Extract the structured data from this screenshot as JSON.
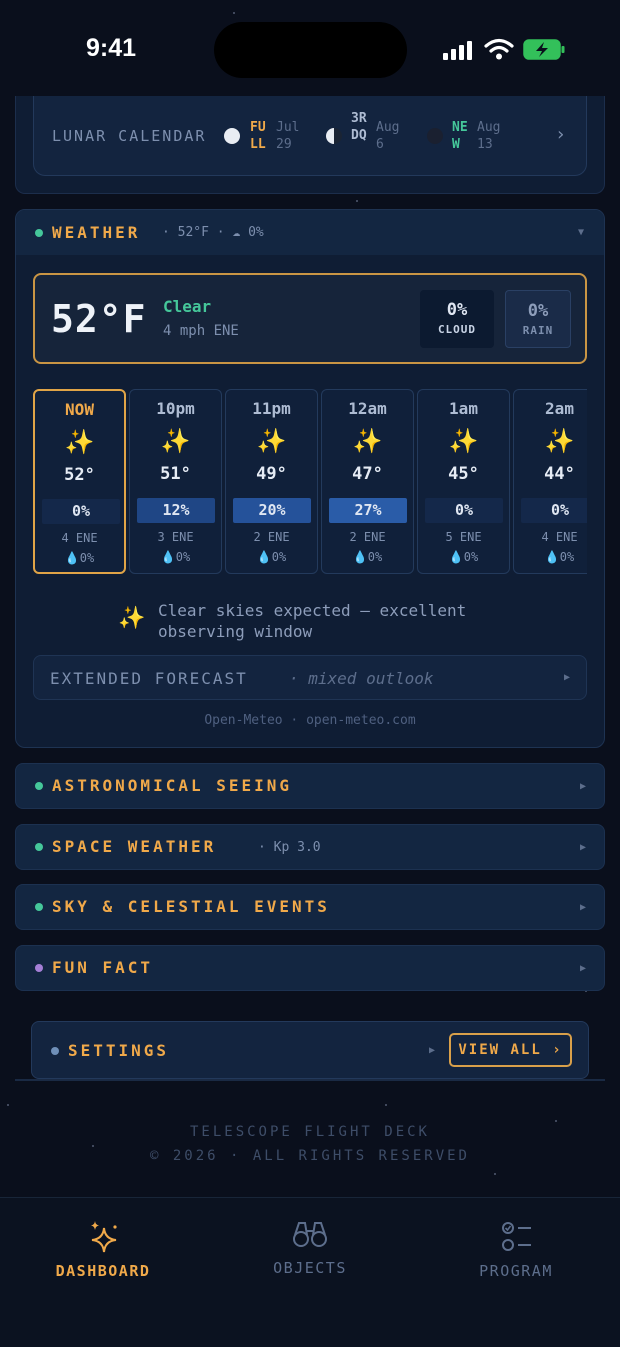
{
  "status_bar": {
    "time": "9:41"
  },
  "lunar": {
    "title": "LUNAR CALENDAR",
    "phases": [
      {
        "name": "FULL",
        "date": "Jul 29",
        "color": "#f0a94a"
      },
      {
        "name": "3RDQ",
        "date": "Aug 6",
        "color": "#aebcd3"
      },
      {
        "name": "NEW",
        "date": "Aug 13",
        "color": "#45c79a"
      }
    ]
  },
  "weather": {
    "title": "WEATHER",
    "summary": "· 52°F · ☁ 0%",
    "current": {
      "temp": "52°F",
      "condition": "Clear",
      "wind": "4 mph ENE"
    },
    "cloud": {
      "value": "0%",
      "label": "CLOUD"
    },
    "rain": {
      "value": "0%",
      "label": "RAIN"
    },
    "hourly": [
      {
        "label": "NOW",
        "icon": "✨",
        "temp": "52°",
        "cloud": "0%",
        "cloud_fraction": 0,
        "wind": "4 ENE",
        "rain": "💧0%"
      },
      {
        "label": "10pm",
        "icon": "✨",
        "temp": "51°",
        "cloud": "12%",
        "cloud_fraction": 0.12,
        "wind": "3 ENE",
        "rain": "💧0%"
      },
      {
        "label": "11pm",
        "icon": "✨",
        "temp": "49°",
        "cloud": "20%",
        "cloud_fraction": 0.2,
        "wind": "2 ENE",
        "rain": "💧0%"
      },
      {
        "label": "12am",
        "icon": "✨",
        "temp": "47°",
        "cloud": "27%",
        "cloud_fraction": 0.27,
        "wind": "2 ENE",
        "rain": "💧0%"
      },
      {
        "label": "1am",
        "icon": "✨",
        "temp": "45°",
        "cloud": "0%",
        "cloud_fraction": 0,
        "wind": "5 ENE",
        "rain": "💧0%"
      },
      {
        "label": "2am",
        "icon": "✨",
        "temp": "44°",
        "cloud": "0%",
        "cloud_fraction": 0,
        "wind": "4 ENE",
        "rain": "💧0%"
      }
    ],
    "observing_icon": "✨",
    "observing_line1": "Clear skies expected — excellent",
    "observing_line2": "observing window",
    "extended_title": "EXTENDED FORECAST",
    "extended_sub": "· mixed outlook",
    "source": "Open-Meteo · open-meteo.com"
  },
  "panels": {
    "seeing": {
      "title": "ASTRONOMICAL SEEING",
      "dot_color": "#45c79a"
    },
    "space_weather": {
      "title": "SPACE WEATHER",
      "sub": "· Kp 3.0",
      "dot_color": "#45c79a"
    },
    "sky_events": {
      "title": "SKY & CELESTIAL EVENTS",
      "dot_color": "#45c79a"
    },
    "fun_fact": {
      "title": "FUN FACT",
      "dot_color": "#a57fd6"
    }
  },
  "settings": {
    "title": "SETTINGS",
    "view_all": "VIEW ALL ›"
  },
  "footer": {
    "line1": "TELESCOPE FLIGHT DECK",
    "line2": "© 2026 · ALL RIGHTS RESERVED"
  },
  "tabs": [
    {
      "label": "DASHBOARD",
      "icon": "sparkles-icon",
      "active": true
    },
    {
      "label": "OBJECTS",
      "icon": "binoculars-icon",
      "active": false
    },
    {
      "label": "PROGRAM",
      "icon": "checklist-icon",
      "active": false
    }
  ],
  "colors": {
    "accent": "#f0a94a",
    "good": "#45c79a",
    "background": "#0a0f1c"
  }
}
